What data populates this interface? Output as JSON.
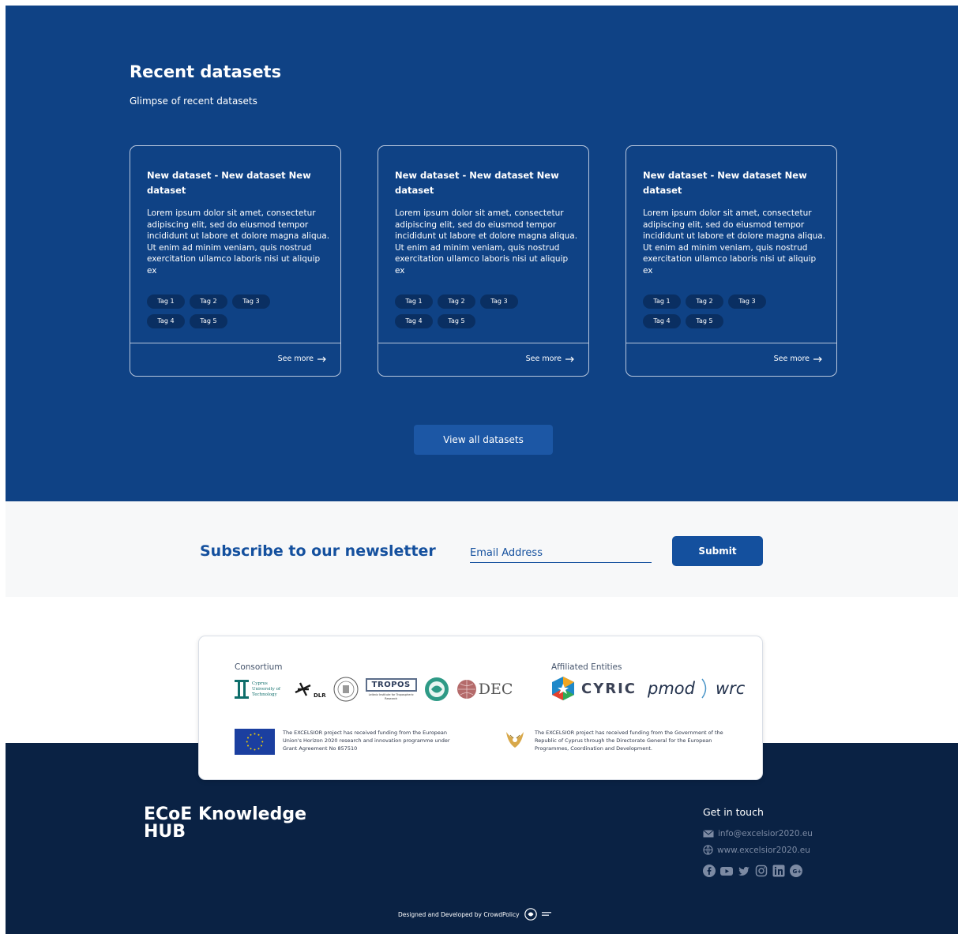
{
  "datasets": {
    "title": "Recent datasets",
    "subtitle": "Glimpse of recent datasets",
    "cards": [
      {
        "title": "New dataset - New dataset New dataset",
        "description": "Lorem ipsum dolor sit amet, consectetur adipiscing elit, sed do eiusmod tempor incididunt ut labore et dolore magna aliqua. Ut enim ad minim veniam, quis nostrud exercitation ullamco laboris nisi ut aliquip ex",
        "tags": [
          "Tag 1",
          "Tag 2",
          "Tag 3",
          "Tag 4",
          "Tag 5"
        ],
        "see_more": "See more"
      },
      {
        "title": "New dataset - New dataset New dataset",
        "description": "Lorem ipsum dolor sit amet, consectetur adipiscing elit, sed do eiusmod tempor incididunt ut labore et dolore magna aliqua. Ut enim ad minim veniam, quis nostrud exercitation ullamco laboris nisi ut aliquip ex",
        "tags": [
          "Tag 1",
          "Tag 2",
          "Tag 3",
          "Tag 4",
          "Tag 5"
        ],
        "see_more": "See more"
      },
      {
        "title": "New dataset - New dataset New dataset",
        "description": "Lorem ipsum dolor sit amet, consectetur adipiscing elit, sed do eiusmod tempor incididunt ut labore et dolore magna aliqua. Ut enim ad minim veniam, quis nostrud exercitation ullamco laboris nisi ut aliquip ex",
        "tags": [
          "Tag 1",
          "Tag 2",
          "Tag 3",
          "Tag 4",
          "Tag 5"
        ],
        "see_more": "See more"
      }
    ],
    "view_all_label": "View all datasets"
  },
  "newsletter": {
    "title": "Subscribe to our newsletter",
    "email_placeholder": "Email Address",
    "submit_label": "Submit"
  },
  "partners": {
    "consortium_label": "Consortium",
    "affiliated_label": "Affiliated Entities",
    "logos": {
      "cut_name": "Cyprus University of Technology",
      "dlr": "DLR",
      "tropos": "TROPOS",
      "tropos_sub": "Leibniz Institute for Tropospheric Research",
      "dec": "DEC",
      "cyric": "CYRIC",
      "pmod": "pmod",
      "wrc": "wrc"
    },
    "eu_funding": "The EXCELSIOR project has received funding from the European Union's Horizon 2020 research and innovation programme under Grant Agreement No 857510",
    "cy_funding": "The EXCELSIOR project has received funding from the Government of the Republic of Cyprus through the Directorate General for the European Programmes, Coordination and Development."
  },
  "footer": {
    "brand": "ECoE Knowledge HUB",
    "get_in_touch": "Get in touch",
    "email": "info@excelsior2020.eu",
    "website": "www.excelsior2020.eu",
    "socials": [
      "facebook-icon",
      "youtube-icon",
      "twitter-icon",
      "instagram-icon",
      "linkedin-icon",
      "google-plus-icon"
    ],
    "credit": "Designed and Developed by CrowdPolicy"
  },
  "colors": {
    "primary": "#0f4285",
    "accent": "#14509e",
    "footer_bg": "#0a2244",
    "tag_bg": "#0a2f62"
  }
}
